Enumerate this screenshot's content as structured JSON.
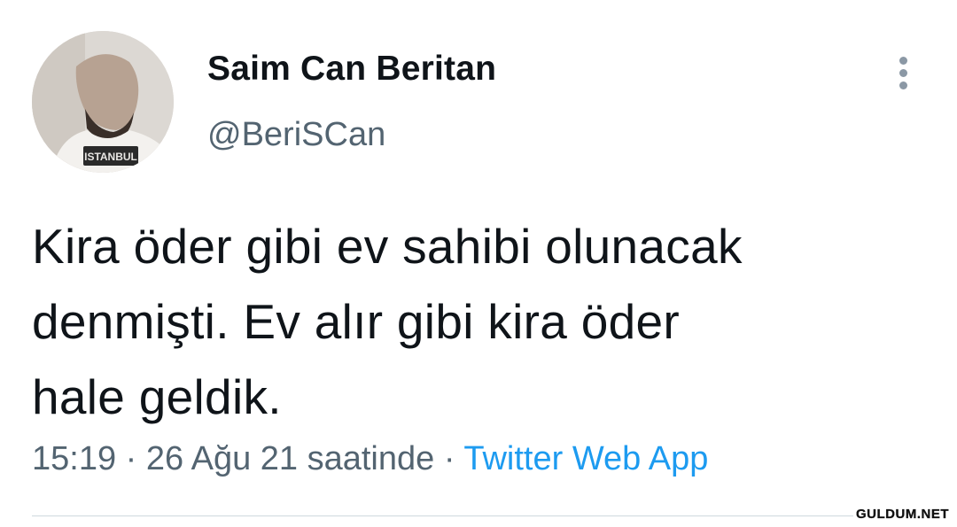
{
  "author": {
    "display_name": "Saim Can Beritan",
    "handle": "@BeriSCan",
    "avatar_shirt_text": "ISTANBUL"
  },
  "more_icon": "more-vertical-icon",
  "tweet": {
    "text_lines": [
      "Kira öder gibi ev sahibi olunacak",
      "denmişti. Ev alır gibi kira öder",
      "hale geldik."
    ],
    "time": "15:19",
    "separator": "·",
    "date": "26 Ağu 21 saatinde",
    "source": "Twitter Web App"
  },
  "watermark": "GULDUM.NET",
  "colors": {
    "text": "#0f1419",
    "secondary": "#536471",
    "link": "#1d9bf0",
    "divider": "#cfd9de"
  }
}
